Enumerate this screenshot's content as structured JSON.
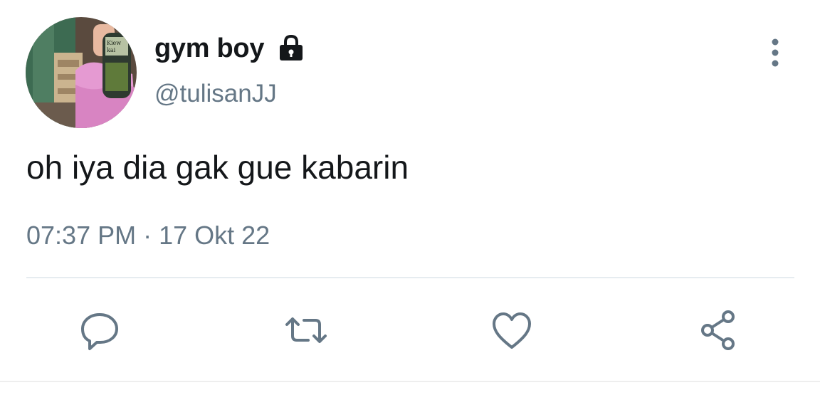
{
  "tweet": {
    "display_name": "gym boy",
    "handle": "@tulisanJJ",
    "text": "oh iya dia gak gue kabarin",
    "timestamp": "07:37 PM · 17 Okt 22",
    "avatar_jar_text": "Kiew kai ka"
  },
  "icons": {
    "lock": "lock-icon",
    "more": "more-vertical-icon",
    "reply": "reply-icon",
    "retweet": "retweet-icon",
    "like": "heart-icon",
    "share": "share-icon"
  },
  "colors": {
    "text_primary": "#14171a",
    "text_secondary": "#657786",
    "icon": "#657786",
    "divider": "#e6ecf0"
  }
}
